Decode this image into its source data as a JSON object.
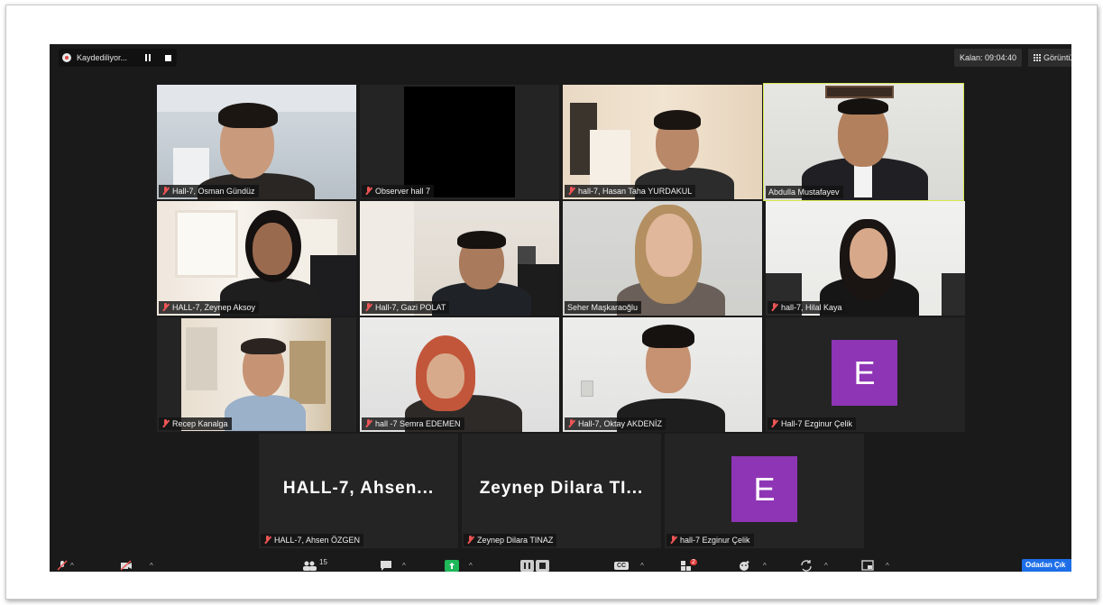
{
  "recording": {
    "label": "Kaydediliyor..."
  },
  "header": {
    "timer": "Kalan: 09:04:40",
    "view_label": "Görüntü"
  },
  "participants": [
    {
      "name": "Hall-7, Osman Gündüz",
      "muted": true
    },
    {
      "name": "Observer hall 7",
      "muted": true
    },
    {
      "name": "hall-7, Hasan Taha YURDAKUL",
      "muted": true
    },
    {
      "name": "Abdulla Mustafayev",
      "muted": false,
      "active_speaker": true
    },
    {
      "name": "HALL-7, Zeynep Aksoy",
      "muted": true
    },
    {
      "name": "Hall-7, Gazi POLAT",
      "muted": true
    },
    {
      "name": "Seher Maşkaraoğlu",
      "muted": false
    },
    {
      "name": "hall-7, Hilal Kaya",
      "muted": true
    },
    {
      "name": "Recep Kanalga",
      "muted": true
    },
    {
      "name": "hall -7 Semra EDEMEN",
      "muted": true
    },
    {
      "name": "Hall-7, Oktay AKDENİZ",
      "muted": true
    },
    {
      "name": "Hall-7 Ezginur Çelik",
      "muted": true,
      "avatar_letter": "E"
    },
    {
      "name": "HALL-7, Ahsen ÖZGEN",
      "muted": true,
      "display_name": "HALL-7,  Ahsen..."
    },
    {
      "name": "Zeynep Dilara TINAZ",
      "muted": true,
      "display_name": "Zeynep Dilara TI..."
    },
    {
      "name": "hall-7 Ezginur Çelik",
      "muted": true,
      "avatar_letter": "E"
    }
  ],
  "toolbar": {
    "participants_count": "15",
    "cc_label": "CC",
    "apps_badge": "2",
    "end_label": "Odadan Çık"
  },
  "colors": {
    "avatar": "#8e35b5",
    "active_outline": "#d7e84f",
    "end_button": "#1e6ee8",
    "muted_icon": "#e55555"
  }
}
